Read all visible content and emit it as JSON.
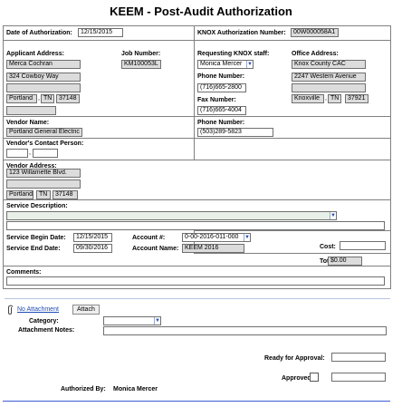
{
  "page": {
    "title": "KEEM - Post-Audit Authorization"
  },
  "auth": {
    "date_label": "Date of Authorization:",
    "date": "12/15/2015",
    "number_label": "KNOX Authorization Number:",
    "number": "00W000058A1"
  },
  "applicant": {
    "label": "Applicant Address:",
    "name": "Merca Cochran",
    "street": "324 Cowboy Way",
    "line2": "",
    "city": "Portland",
    "state": "TN",
    "zip": "37148",
    "extra": ""
  },
  "job": {
    "label": "Job Number:",
    "value": "KM100053L"
  },
  "staff": {
    "label": "Requesting KNOX staff:",
    "value": "Monica Mercer",
    "phone_label": "Phone Number:",
    "phone": "(716)665-2800",
    "fax_label": "Fax Number:",
    "fax": "(716)665-4004"
  },
  "office": {
    "label": "Office Address:",
    "name": "Knox County CAC",
    "street": "2247 Western Avenue",
    "line2": "",
    "city": "Knoxville",
    "state": "TN",
    "zip": "37921"
  },
  "vendor": {
    "name_label": "Vendor Name:",
    "name": "Portland General Electric",
    "phone_label": "Phone Number:",
    "phone": "(503)289-5823",
    "contact_label": "Vendor's Contact Person:",
    "contact_first": "",
    "contact_last": "",
    "address_label": "Vendor Address:",
    "street": "123 Willamette Blvd.",
    "line2": "",
    "city": "Portland",
    "state": "TN",
    "zip": "37148"
  },
  "service": {
    "desc_label": "Service Description:",
    "desc_value": "",
    "begin_label": "Service Begin Date:",
    "begin": "12/15/2015",
    "end_label": "Service End Date:",
    "end": "09/30/2016",
    "account_label": "Account #:",
    "account": "0-00-2016-011-000",
    "account_name_label": "Account Name:",
    "account_name": "KEEM 2016",
    "cost_label": "Cost:",
    "cost": "",
    "total_label": "Total:",
    "total": "$0.00"
  },
  "comments": {
    "label": "Comments:",
    "value": ""
  },
  "attachment": {
    "link": "No Attachment",
    "button": "Attach",
    "category_label": "Category:",
    "category": "",
    "notes_label": "Attachment Notes:",
    "notes": ""
  },
  "approval": {
    "ready_label": "Ready for Approval:",
    "ready": "",
    "approved_label": "Approved?",
    "approved_value": "",
    "authorized_label": "Authorized By:",
    "authorized_by": "Monica Mercer"
  },
  "colors": {
    "readonly_fill": "#dcdcdc",
    "border": "#808080",
    "link": "#1e4bb8",
    "bottom_rule": "#3b5bd6"
  }
}
